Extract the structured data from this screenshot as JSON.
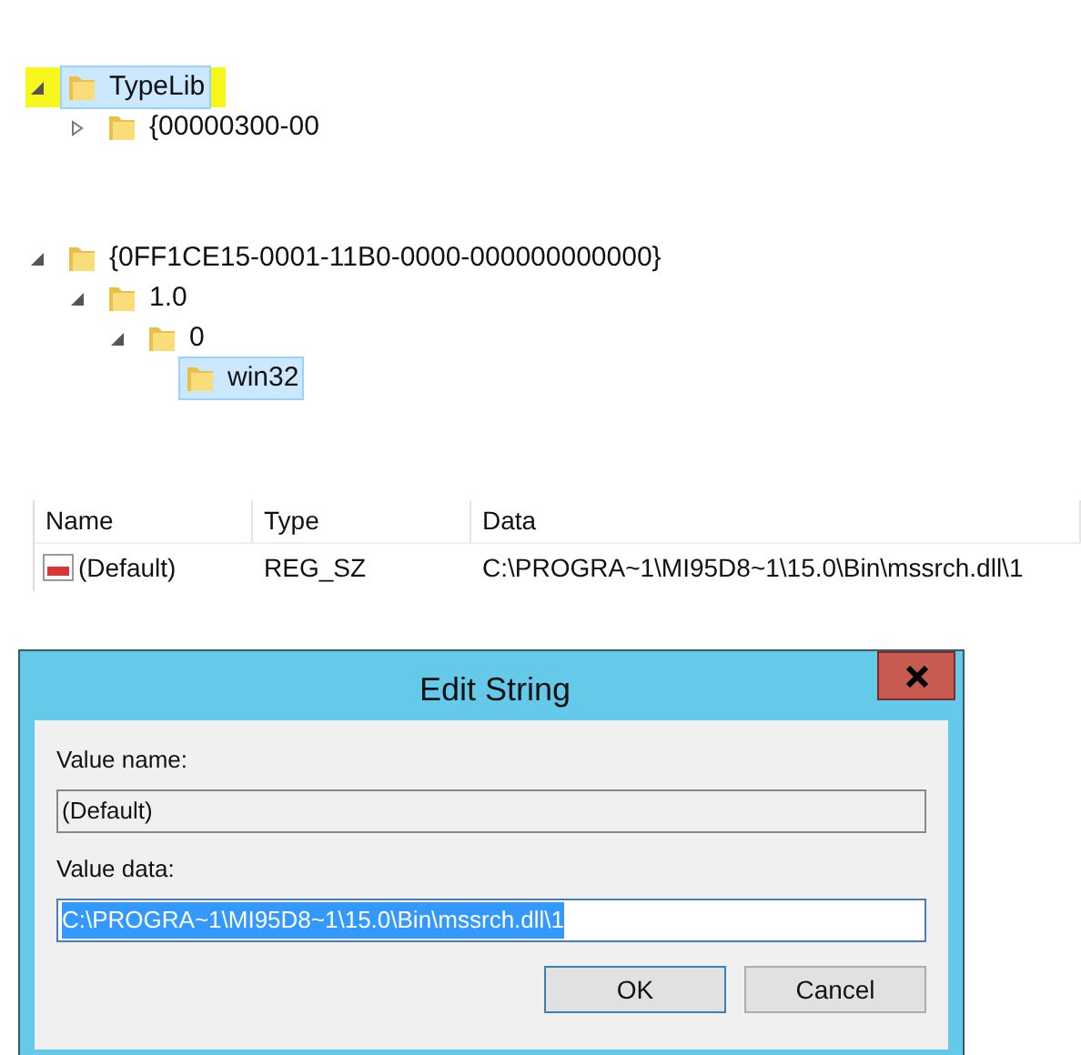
{
  "tree_top": [
    {
      "label": "TypeLib",
      "expanded": true,
      "selected": true,
      "highlighted": true,
      "children": [
        {
          "label": "{00000300-00",
          "expanded": false,
          "selected": false,
          "highlighted": false
        }
      ]
    }
  ],
  "tree_bottom": [
    {
      "label": "{0FF1CE15-0001-11B0-0000-000000000000}",
      "expanded": true,
      "selected": false,
      "highlighted": false,
      "children": [
        {
          "label": "1.0",
          "expanded": true,
          "selected": false,
          "highlighted": false,
          "children": [
            {
              "label": "0",
              "expanded": true,
              "selected": false,
              "highlighted": false,
              "children": [
                {
                  "label": "win32",
                  "selected": true,
                  "highlighted": false
                }
              ]
            }
          ]
        }
      ]
    }
  ],
  "table": {
    "columns": [
      "Name",
      "Type",
      "Data"
    ],
    "rows": [
      {
        "name": "(Default)",
        "type": "REG_SZ",
        "data": "C:\\PROGRA~1\\MI95D8~1\\15.0\\Bin\\mssrch.dll\\1"
      }
    ]
  },
  "dialog": {
    "title": "Edit String",
    "value_name_label": "Value name:",
    "value_name": "(Default)",
    "value_data_label": "Value data:",
    "value_data": "C:\\PROGRA~1\\MI95D8~1\\15.0\\Bin\\mssrch.dll\\1",
    "buttons": [
      {
        "label": "OK",
        "default": true
      },
      {
        "label": "Cancel",
        "default": false
      }
    ]
  }
}
